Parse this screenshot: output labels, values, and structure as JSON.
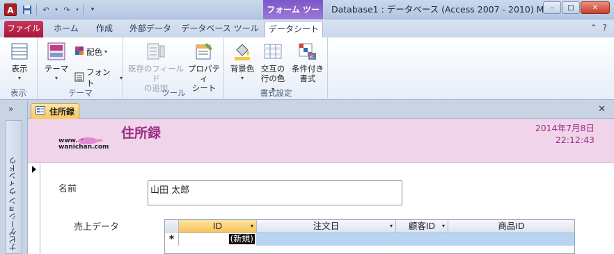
{
  "titlebar": {
    "app_icon": "A",
    "context_tab": "フォーム ツール",
    "window_title": "Database1 : データベース (Access 2007 - 2010) M...",
    "buttons": {
      "minimize": "–",
      "maximize": "□",
      "close": "✕"
    }
  },
  "tabs": {
    "file": "ファイル",
    "home": "ホーム",
    "create": "作成",
    "external": "外部データ",
    "dbtools": "データベース ツール",
    "datasheet": "データシート"
  },
  "ribbon": {
    "view": {
      "label": "表示",
      "group": "表示"
    },
    "theme": {
      "label": "テーマ",
      "colors": "配色",
      "fonts": "フォント",
      "group": "テーマ"
    },
    "tools": {
      "add_fields_1": "既存のフィールド",
      "add_fields_2": "の追加",
      "props_1": "プロパティ",
      "props_2": "シート",
      "group": "ツール"
    },
    "format": {
      "bg": "背景色",
      "alt_1": "交互の",
      "alt_2": "行の色",
      "cond_1": "条件付き",
      "cond_2": "書式",
      "group": "書式設定"
    }
  },
  "nav": {
    "toggle": "»",
    "strip_label": "ナビゲーション ウィンドウ"
  },
  "document": {
    "tab_label": "住所録",
    "close": "✕",
    "logo_line1": "www.",
    "logo_line2": "wanichan.com",
    "title": "住所録",
    "date": "2014年7月8日",
    "time": "22:12:43",
    "name_label": "名前",
    "name_value": "山田 太郎",
    "sales_label": "売上データ"
  },
  "datasheet": {
    "columns": [
      "ID",
      "注文日",
      "顧客ID",
      "商品ID"
    ],
    "new_row_marker": "*",
    "new_label": "(新規)"
  },
  "colors": {
    "accent": "#9c2d87",
    "header_bg": "#f0d4ea",
    "context": "#8a63cf"
  }
}
